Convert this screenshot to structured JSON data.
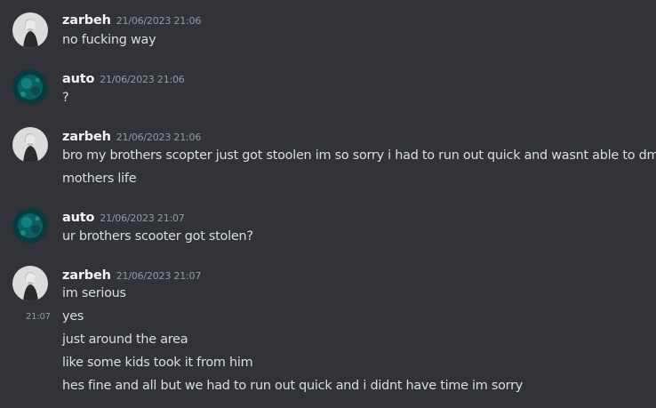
{
  "messages": [
    {
      "author": "zarbeh",
      "avatar": "zarbeh-avatar",
      "time": "21/06/2023 21:06",
      "lines": [
        "no fucking way"
      ]
    },
    {
      "author": "auto",
      "avatar": "auto-avatar",
      "time": "21/06/2023 21:06",
      "lines": [
        "?"
      ]
    },
    {
      "author": "zarbeh",
      "avatar": "zarbeh-avatar",
      "time": "21/06/2023 21:06",
      "lines": [
        "bro my brothers scopter just got stoolen im so sorry i had to run out quick and wasnt able to dm u",
        "mothers life"
      ]
    },
    {
      "author": "auto",
      "avatar": "auto-avatar",
      "time": "21/06/2023 21:07",
      "lines": [
        "ur brothers scooter got stolen?"
      ]
    },
    {
      "author": "zarbeh",
      "avatar": "zarbeh-avatar",
      "time": "21/06/2023 21:07",
      "lines": [
        "im serious",
        "yes",
        "just around the area",
        "like some kids took it from him",
        "hes fine and all but we had to run out quick and i didnt have time im sorry"
      ],
      "hover_time": "21:07"
    }
  ],
  "colors": {
    "background": "#313338",
    "username": "#f2f3f5",
    "message_text": "#dbdee1",
    "timestamp": "#949ba4"
  }
}
